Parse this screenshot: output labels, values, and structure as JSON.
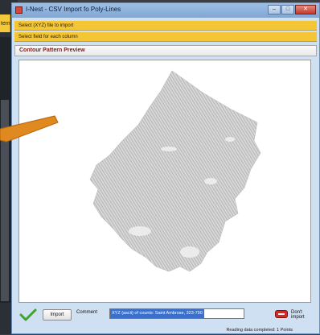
{
  "background": {
    "left_strip_text": "tem"
  },
  "window": {
    "title": "I-Nest - CSV Import fo Poly-Lines",
    "controls": {
      "minimize": "–",
      "maximize": "□",
      "close": "✕"
    }
  },
  "steps": [
    {
      "label": "Select (XYZ) file to import"
    },
    {
      "label": "Select field for each column"
    }
  ],
  "preview": {
    "header": "Contour Pattern Preview"
  },
  "bottom_bar": {
    "import_label": "Import",
    "comment_label": "Comment",
    "comment_value": "XYZ (ascii) of counts: Saint Ambrose, 323-790",
    "dont_import_label": "Don't import"
  },
  "status": {
    "text": "Reading data completed: 1 Points"
  },
  "colors": {
    "accent_yellow": "#f4c636",
    "title_bar": "#8fb3dd",
    "contour": "#b5b5b5",
    "arrow": "#e0891f"
  }
}
